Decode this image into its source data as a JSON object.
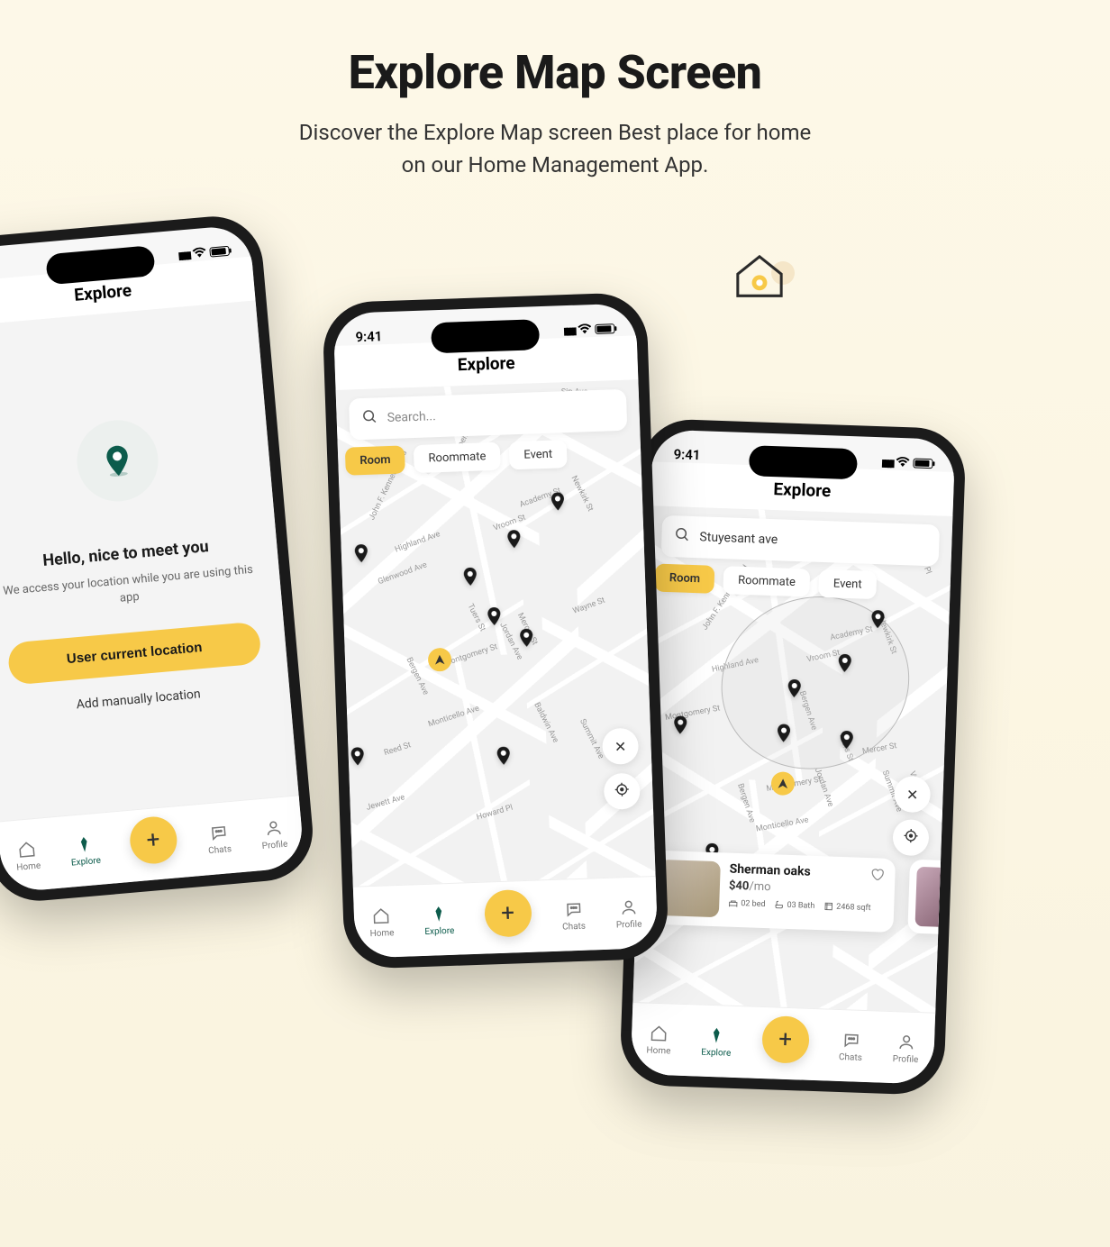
{
  "hero": {
    "title": "Explore Map Screen",
    "subtitle_line1": "Discover the Explore Map screen Best place for home",
    "subtitle_line2": "on our Home Management App."
  },
  "status": {
    "time": "9:41"
  },
  "screen_title": "Explore",
  "phone1": {
    "greeting": "Hello, nice to meet you",
    "sub": "We access your location while you are using this app",
    "cta": "User current location",
    "manual": "Add manually location"
  },
  "search": {
    "placeholder": "Search...",
    "query_p3": "Stuyesant ave"
  },
  "chips": {
    "room": "Room",
    "roommate": "Roommate",
    "event": "Event"
  },
  "nav": {
    "home": "Home",
    "explore": "Explore",
    "chats": "Chats",
    "profile": "Profile"
  },
  "listing": {
    "name": "Sherman oaks",
    "price": "$40",
    "price_unit": "/mo",
    "beds": "02 bed",
    "baths": "03 Bath",
    "area": "2468 sqft"
  },
  "streets": [
    "Sip Ave",
    "Van Reypen St",
    "Newkirk St",
    "Academy St",
    "Vroom St",
    "Highland Ave",
    "Glenwood Ave",
    "Mercer St",
    "Jordan Ave",
    "Tuers St",
    "Wayne St",
    "Montgomery St",
    "Monticello Ave",
    "Reed St",
    "Jewett Ave",
    "Bergen Ave",
    "Howard Pl",
    "Summit Ave",
    "Baldwin Ave",
    "John F. Kennedy Blvd",
    "Enos Pl"
  ]
}
